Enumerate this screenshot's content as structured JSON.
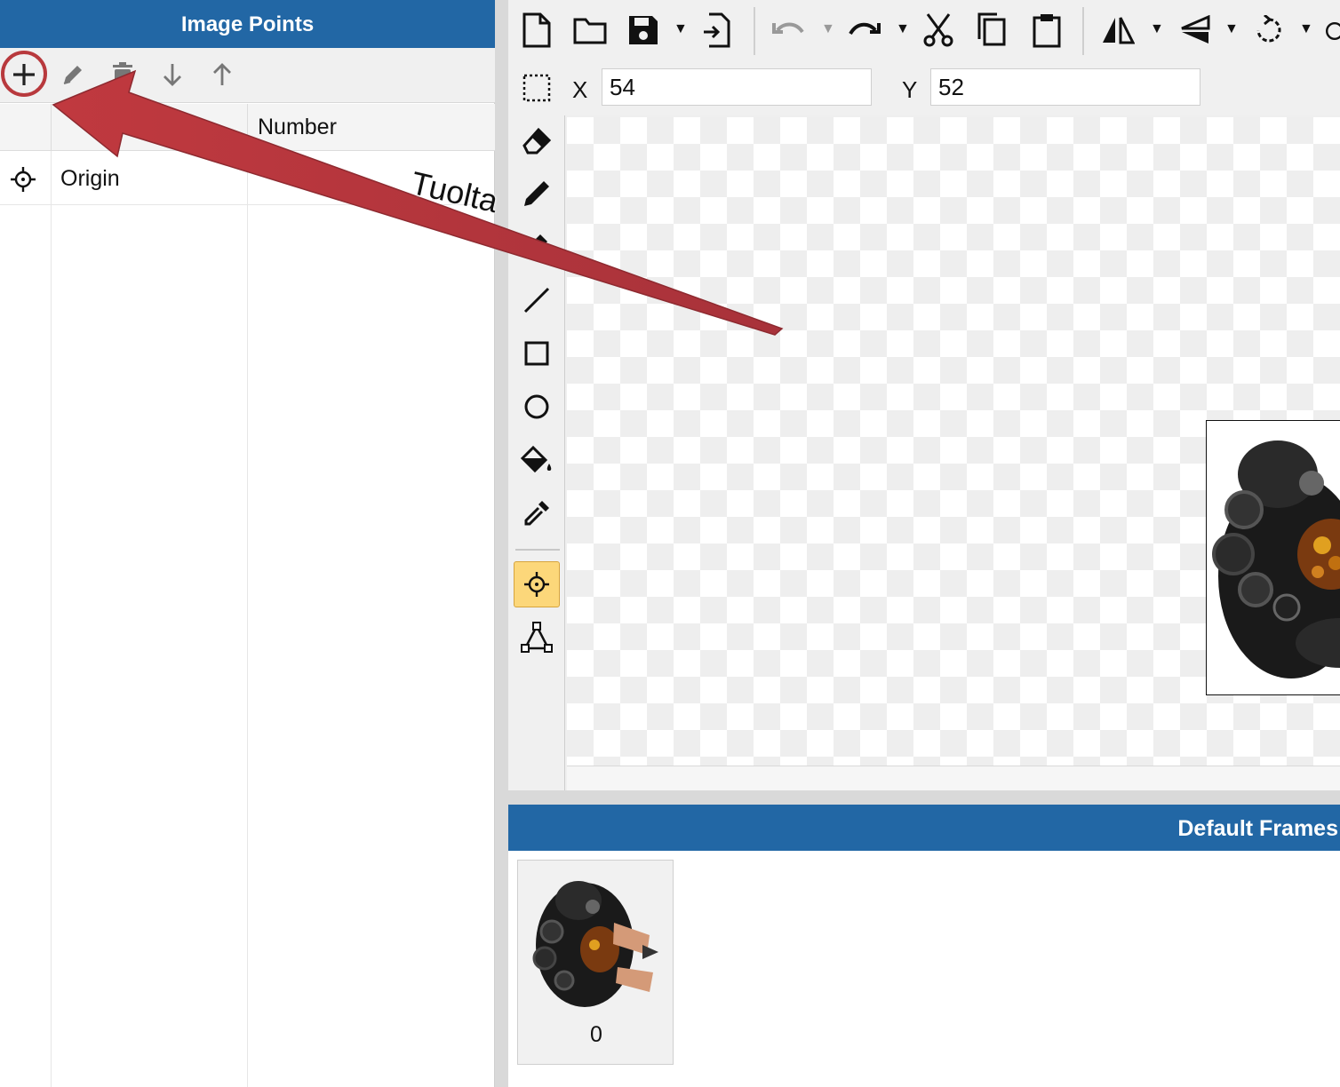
{
  "left_panel": {
    "title": "Image Points",
    "toolbar": {
      "icons": [
        "add-icon",
        "edit-icon",
        "delete-icon",
        "move-down-icon",
        "move-up-icon"
      ]
    },
    "table": {
      "columns": [
        "",
        "Number"
      ],
      "rows": [
        {
          "icon": "crosshair-icon",
          "name": "Origin"
        }
      ]
    }
  },
  "editor": {
    "toolbar_icons": [
      "new-file-icon",
      "open-folder-icon",
      "save-icon",
      "export-icon",
      "undo-icon",
      "redo-icon",
      "cut-icon",
      "copy-icon",
      "paste-icon",
      "flip-horizontal-icon",
      "flip-vertical-icon",
      "rotate-icon"
    ],
    "coords": {
      "x_label": "X",
      "x_value": "54",
      "y_label": "Y",
      "y_value": "52"
    },
    "tools": [
      "selection-icon",
      "eraser-icon",
      "pencil-icon",
      "brush-icon",
      "line-icon",
      "rectangle-icon",
      "ellipse-icon",
      "fill-bucket-icon",
      "eyedropper-icon",
      "image-point-icon",
      "polygon-icon"
    ],
    "active_tool": "image-point-icon"
  },
  "frames": {
    "title": "Default Frames",
    "items": [
      {
        "label": "0"
      }
    ]
  },
  "annotation": {
    "text": "Tuolta",
    "color": "#b8393d"
  },
  "colors": {
    "header_blue": "#2267a5",
    "active_tool": "#fcd77a",
    "annotation_red": "#b8393d"
  }
}
